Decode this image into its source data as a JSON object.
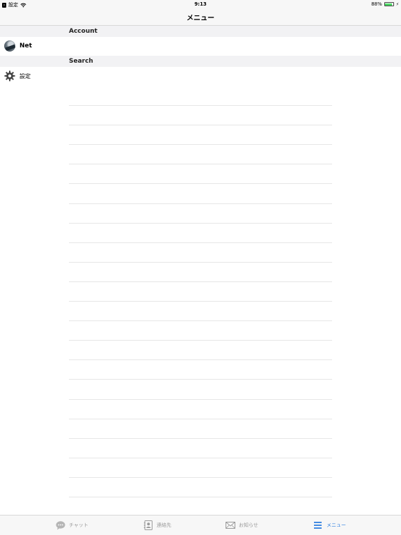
{
  "status_bar": {
    "back_app": "設定",
    "time": "9:13",
    "battery": "88%",
    "battery_level": 0.88
  },
  "nav": {
    "title": "メニュー"
  },
  "sections": {
    "account_header": "Account",
    "search_header": "Search"
  },
  "rows": {
    "account_name": "Net",
    "settings_label": "設定"
  },
  "tabs": [
    {
      "label": "チャット",
      "icon": "chat-bubble-icon"
    },
    {
      "label": "連絡先",
      "icon": "contacts-book-icon"
    },
    {
      "label": "お知らせ",
      "icon": "envelope-icon"
    },
    {
      "label": "メニュー",
      "icon": "menu-lines-icon",
      "active": true
    }
  ],
  "colors": {
    "active_tab": "#2f7fe0",
    "inactive_tab": "#9a9a9a",
    "battery_fill": "#4cd964"
  }
}
